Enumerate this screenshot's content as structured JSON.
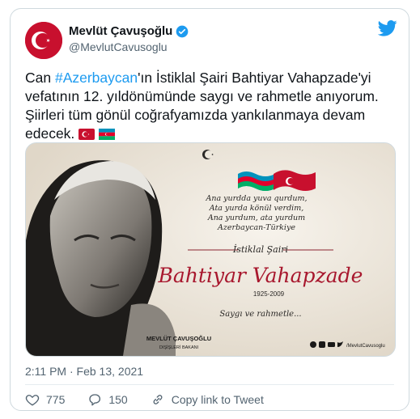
{
  "tweet": {
    "author_name": "Mevlüt Çavuşoğlu",
    "author_handle": "@MevlutCavusoglu",
    "text_before": "Can ",
    "hashtag": "#Azerbaycan",
    "text_after": "'ın İstiklal Şairi Bahtiyar Vahapzade'yi vefatının 12. yıldönümünde saygı ve rahmetle anıyorum. Şiirleri tüm gönül coğrafyamızda yankılanmaya devam edecek.",
    "timestamp": "2:11 PM · Feb 13, 2021"
  },
  "media": {
    "poem_line1": "Ana yurdda yuva qurdum,",
    "poem_line2": "Ata yurda könül verdim,",
    "poem_line3": "Ana yurdum, ata yurdum",
    "poem_line4": "Azerbaycan-Türkiye",
    "subtitle": "İstiklal Şairi",
    "poet_name": "Bahtiyar Vahapzade",
    "years": "1925-2009",
    "respect": "Saygı ve rahmetle...",
    "footer_name": "MEVLÜT ÇAVUŞOĞLU",
    "footer_title": "DIŞİŞLERİ BAKANI",
    "footer_handle": "/MevlutCavusoglu"
  },
  "actions": {
    "likes": "775",
    "replies": "150",
    "copy_link": "Copy link to Tweet"
  },
  "colors": {
    "twitter_blue": "#1d9bf0",
    "text": "#0f1419",
    "secondary": "#536471",
    "turkey_red": "#c8102e",
    "azerbaijan_blue": "#0092bc",
    "azerbaijan_green": "#00af66"
  }
}
